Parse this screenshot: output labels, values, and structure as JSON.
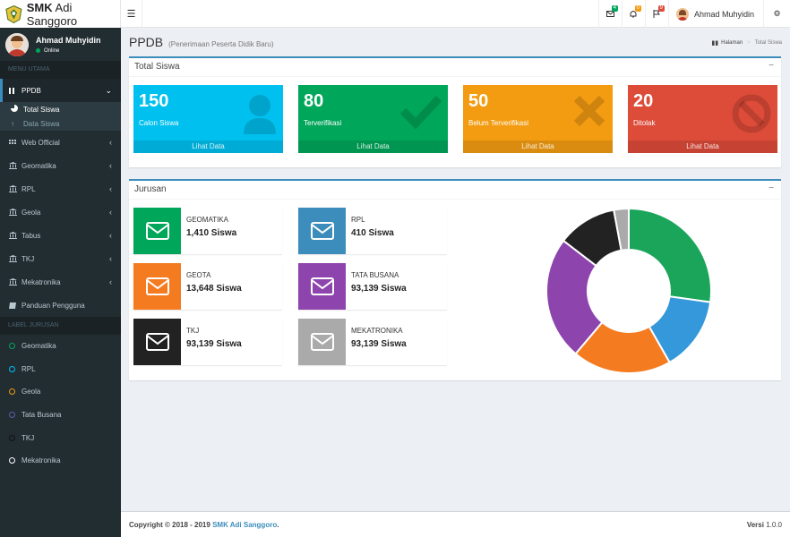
{
  "app": {
    "brand_bold": "SMK",
    "brand_rest": "Adi Sanggoro"
  },
  "topbar": {
    "mail_count": "4",
    "notif_count": "0",
    "flag_count": "9",
    "user_name": "Ahmad Muhyidin",
    "colors": {
      "mail": "#00a65a",
      "notif": "#f39c12",
      "flag": "#dd4b39"
    }
  },
  "sidebar": {
    "user_name": "Ahmad Muhyidin",
    "status": "Online",
    "header_main": "MENU UTAMA",
    "menu": [
      {
        "label": "PPDB",
        "icon": "chart-bar-icon"
      },
      {
        "label": "Web Official",
        "icon": "grid-icon"
      },
      {
        "label": "Geomatika",
        "icon": "bank-icon"
      },
      {
        "label": "RPL",
        "icon": "bank-icon"
      },
      {
        "label": "Geola",
        "icon": "bank-icon"
      },
      {
        "label": "Tabus",
        "icon": "bank-icon"
      },
      {
        "label": "TKJ",
        "icon": "bank-icon"
      },
      {
        "label": "Mekatronika",
        "icon": "bank-icon"
      },
      {
        "label": "Panduan Pengguna",
        "icon": "book-icon"
      }
    ],
    "submenu": [
      {
        "label": "Total Siswa",
        "icon": "pie-icon"
      },
      {
        "label": "Data Siswa",
        "icon": "upload-icon"
      }
    ],
    "header_labels": "LABEL JURUSAN",
    "labels": [
      {
        "label": "Geomatika",
        "color": "#00a65a"
      },
      {
        "label": "RPL",
        "color": "#00c0ef"
      },
      {
        "label": "Geola",
        "color": "#f39c12"
      },
      {
        "label": "Tata Busana",
        "color": "#605ca8"
      },
      {
        "label": "TKJ",
        "color": "#111111"
      },
      {
        "label": "Mekatronika",
        "color": "#ffffff"
      }
    ]
  },
  "page": {
    "title": "PPDB",
    "subtitle": "(Penerimaan Peserta Didik Baru)",
    "breadcrumb_home": "Halaman",
    "breadcrumb_current": "Total Siswa"
  },
  "total_box": {
    "title": "Total Siswa",
    "stats": [
      {
        "value": "150",
        "label": "Calon Siswa",
        "link": "Lihat Data",
        "color": "#00c0ef",
        "icon": "user-icon"
      },
      {
        "value": "80",
        "label": "Terverifikasi",
        "link": "Lihat Data",
        "color": "#00a65a",
        "icon": "check-icon"
      },
      {
        "value": "50",
        "label": "Belum Terverifikasi",
        "link": "Lihat Data",
        "color": "#f39c12",
        "icon": "times-icon"
      },
      {
        "value": "20",
        "label": "Ditolak",
        "link": "Lihat Data",
        "color": "#dd4b39",
        "icon": "ban-icon"
      }
    ]
  },
  "jurusan_box": {
    "title": "Jurusan",
    "items": [
      {
        "name": "GEOMATIKA",
        "count": "1,410 Siswa",
        "color": "#00a65a"
      },
      {
        "name": "RPL",
        "count": "410 Siswa",
        "color": "#3c8dbc"
      },
      {
        "name": "GEOTA",
        "count": "13,648 Siswa",
        "color": "#f47b20"
      },
      {
        "name": "TATA BUSANA",
        "count": "93,139 Siswa",
        "color": "#8e44ad"
      },
      {
        "name": "TKJ",
        "count": "93,139 Siswa",
        "color": "#222222"
      },
      {
        "name": "MEKATRONIKA",
        "count": "93,139 Siswa",
        "color": "#aaaaaa"
      }
    ]
  },
  "chart_data": {
    "type": "pie",
    "values": [
      28,
      15,
      20,
      25,
      12,
      3
    ],
    "colors": [
      "#1aa55a",
      "#3498db",
      "#f47b20",
      "#8e44ad",
      "#222222",
      "#aaaaaa"
    ]
  },
  "footer": {
    "copyright": "Copyright © 2018 - 2019",
    "org": "SMK Adi Sanggoro",
    "dot": ".",
    "version_label": "Versi",
    "version": "1.0.0"
  }
}
